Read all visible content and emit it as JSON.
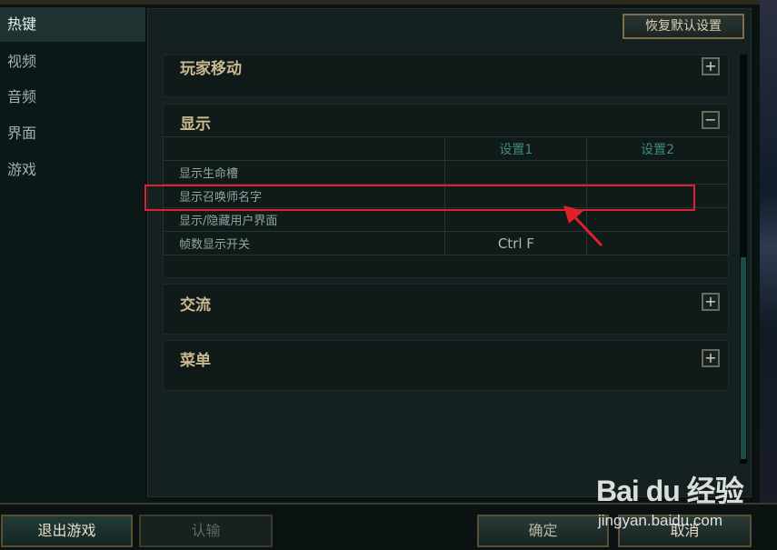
{
  "sidebar": {
    "items": [
      {
        "label": "热键",
        "active": true
      },
      {
        "label": "视频"
      },
      {
        "label": "音频"
      },
      {
        "label": "界面"
      },
      {
        "label": "游戏"
      }
    ]
  },
  "header": {
    "restore_defaults_label": "恢复默认设置"
  },
  "sections": {
    "player_move": {
      "title": "玩家移动",
      "toggle": "+"
    },
    "display": {
      "title": "显示",
      "toggle": "−",
      "columns": [
        "设置1",
        "设置2"
      ],
      "rows": [
        {
          "label": "显示生命槽",
          "setting1": "",
          "setting2": ""
        },
        {
          "label": "显示召唤师名字",
          "setting1": "",
          "setting2": ""
        },
        {
          "label": "显示/隐藏用户界面",
          "setting1": "",
          "setting2": ""
        },
        {
          "label": "帧数显示开关",
          "setting1": "Ctrl  F",
          "setting2": ""
        }
      ]
    },
    "chat": {
      "title": "交流",
      "toggle": "+"
    },
    "menu": {
      "title": "菜单",
      "toggle": "+"
    }
  },
  "footer": {
    "exit_label": "退出游戏",
    "surrender_label": "认输",
    "confirm_label": "确定",
    "cancel_label": "取消"
  },
  "watermark": {
    "logo": "Bai du 经验",
    "url": "jingyan.baidu.com"
  },
  "colors": {
    "highlight": "#e0202a",
    "accent_gold": "#c9b98e",
    "column_header": "#3f8a80"
  }
}
